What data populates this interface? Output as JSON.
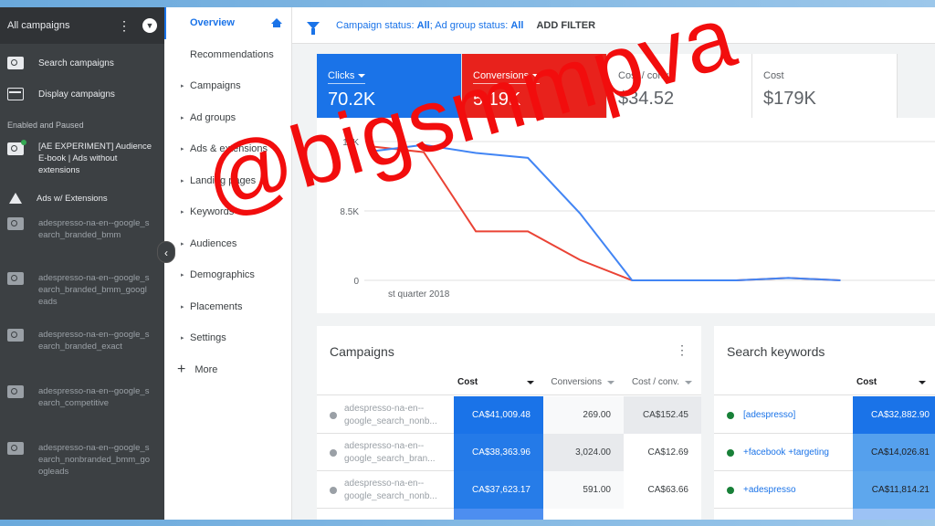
{
  "left_nav": {
    "title": "All campaigns",
    "top_items": [
      {
        "label": "Search campaigns",
        "icon": "search-campaign-icon"
      },
      {
        "label": "Display campaigns",
        "icon": "display-campaign-icon"
      }
    ],
    "section_label": "Enabled and Paused",
    "campaigns": [
      {
        "label": "[AE EXPERIMENT] Audience E-book | Ads without extensions",
        "icon": "search-campaign-icon",
        "active": true
      },
      {
        "label": "Ads w/ Extensions",
        "icon": "experiment-flask-icon",
        "active": true
      },
      {
        "label": "adespresso-na-en--google_search_branded_bmm",
        "icon": "search-campaign-icon",
        "active": false
      },
      {
        "label": "adespresso-na-en--google_search_branded_bmm_googleads",
        "icon": "search-campaign-icon",
        "active": false
      },
      {
        "label": "adespresso-na-en--google_search_branded_exact",
        "icon": "search-campaign-icon",
        "active": false
      },
      {
        "label": "adespresso-na-en--google_search_competitive",
        "icon": "search-campaign-icon",
        "active": false
      },
      {
        "label": "adespresso-na-en--google_search_nonbranded_bmm_googleads",
        "icon": "search-campaign-icon",
        "active": false
      }
    ]
  },
  "page_nav": {
    "items": [
      {
        "label": "Overview",
        "active": true,
        "expandable": false
      },
      {
        "label": "Recommendations",
        "active": false,
        "expandable": false
      },
      {
        "label": "Campaigns",
        "active": false,
        "expandable": true
      },
      {
        "label": "Ad groups",
        "active": false,
        "expandable": true
      },
      {
        "label": "Ads & extensions",
        "active": false,
        "expandable": true
      },
      {
        "label": "Landing pages",
        "active": false,
        "expandable": true
      },
      {
        "label": "Keywords",
        "active": false,
        "expandable": true
      },
      {
        "label": "Audiences",
        "active": false,
        "expandable": true
      },
      {
        "label": "Demographics",
        "active": false,
        "expandable": true
      },
      {
        "label": "Placements",
        "active": false,
        "expandable": true
      },
      {
        "label": "Settings",
        "active": false,
        "expandable": true
      }
    ],
    "more_label": "More"
  },
  "filter_bar": {
    "campaign_status_label": "Campaign status:",
    "campaign_status_value": "All",
    "ad_group_status_label": "Ad group status:",
    "ad_group_status_value": "All",
    "add_filter_label": "ADD FILTER"
  },
  "metrics": [
    {
      "label": "Clicks",
      "value": "70.2K",
      "color": "#1a73e8",
      "selected": true
    },
    {
      "label": "Conversions",
      "value": "5.19K",
      "color": "#e8221c",
      "selected": true
    },
    {
      "label": "Cost / conv.",
      "value": "$34.52",
      "selected": false
    },
    {
      "label": "Cost",
      "value": "$179K",
      "selected": false
    }
  ],
  "chart_data": {
    "type": "line",
    "x": [
      0,
      1,
      2,
      3,
      4,
      5,
      6,
      7,
      8,
      9
    ],
    "x_tick_label": "st quarter 2018",
    "y_ticks": [
      "17K",
      "8.5K",
      "0"
    ],
    "ylim": [
      0,
      17000
    ],
    "series": [
      {
        "color": "#4285f4",
        "values": [
          15800,
          16600,
          15600,
          15000,
          8200,
          0,
          0,
          0,
          300,
          0
        ]
      },
      {
        "color": "#ea4335",
        "values": [
          16400,
          15700,
          6000,
          6000,
          2500,
          0,
          0,
          0,
          300,
          0
        ]
      }
    ],
    "grid": true
  },
  "campaigns_table": {
    "title": "Campaigns",
    "columns": [
      "Cost",
      "Conversions",
      "Cost / conv."
    ],
    "rows": [
      {
        "name": "adespresso-na-en--google_search_nonb...",
        "cost": "CA$41,009.48",
        "conversions": "269.00",
        "cost_conv": "CA$152.45",
        "intensity": 1.0
      },
      {
        "name": "adespresso-na-en--google_search_bran...",
        "cost": "CA$38,363.96",
        "conversions": "3,024.00",
        "cost_conv": "CA$12.69",
        "intensity": 0.92
      },
      {
        "name": "adespresso-na-en--google_search_nonb...",
        "cost": "CA$37,623.17",
        "conversions": "591.00",
        "cost_conv": "CA$63.66",
        "intensity": 0.9
      }
    ]
  },
  "keywords_table": {
    "title": "Search keywords",
    "columns": [
      "Cost"
    ],
    "rows": [
      {
        "keyword": "[adespresso]",
        "cost": "CA$32,882.90",
        "intensity": 1.0
      },
      {
        "keyword": "+facebook +targeting",
        "cost": "CA$14,026.81",
        "intensity": 0.55
      },
      {
        "keyword": "+adespresso",
        "cost": "CA$11,814.21",
        "intensity": 0.48
      }
    ]
  },
  "watermark": {
    "text": "@bigsmmpva",
    "color": "#f20d0d"
  }
}
